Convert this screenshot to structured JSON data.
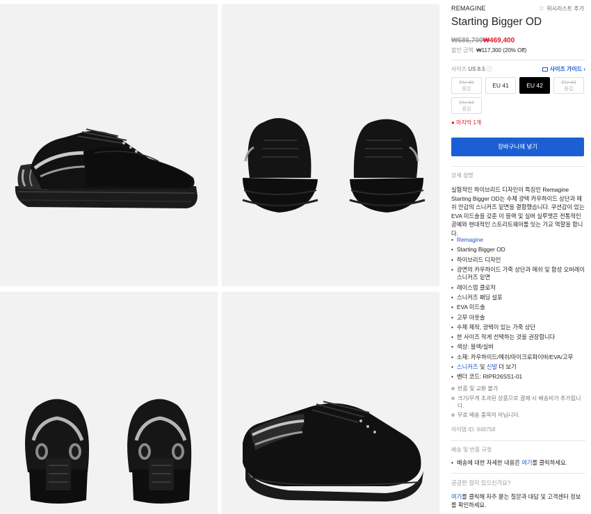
{
  "gallery": {
    "images": [
      {
        "icon": "shoe-side-view-image"
      },
      {
        "icon": "shoe-front-view-image"
      },
      {
        "icon": "shoe-back-view-image"
      },
      {
        "icon": "shoe-angle-view-image"
      }
    ]
  },
  "product": {
    "brand": "REMAGINE",
    "wishlist_label": "위시리스트 추가",
    "title": "Starting Bigger OD",
    "old_price": "₩586,700",
    "new_price": "₩469,400",
    "discount_label": "할인 금액:",
    "discount_value": "₩117,300 (20% Off)"
  },
  "size": {
    "label": "사이즈",
    "selected": "US 8.5",
    "guide_label": "사이즈 가이드",
    "options": [
      {
        "label": "EU 40",
        "sub": "품절",
        "state": "sold"
      },
      {
        "label": "EU 41",
        "sub": "",
        "state": "available"
      },
      {
        "label": "EU 42",
        "sub": "",
        "state": "selected"
      },
      {
        "label": "EU 43",
        "sub": "품절",
        "state": "sold"
      },
      {
        "label": "EU 44",
        "sub": "품절",
        "state": "sold"
      }
    ],
    "stock_note": "마지막 1개"
  },
  "cart": {
    "button_label": "장바구니에 넣기"
  },
  "details": {
    "section_title": "상세 설명",
    "description": "실험적인 하이브리드 디자인이 특징인 Remagine Starting Bigger OD는 수제 광택 카우하이드 상단과 메쉬 안감의 스니커즈 밑면을 결합했습니다. 쿠션감이 있는 EVA 미드솔을 갖춘 이 블랙 및 실버 실루엣은 전통적인 공예와 현대적인 스트리트웨어를 잇는 가교 역할을 합니다.",
    "bullets": [
      {
        "text": "Remagine",
        "link": true
      },
      {
        "text": "Starting Bigger OD",
        "link": false
      },
      {
        "text": "하이브리드 디자인",
        "link": false
      },
      {
        "text": "광면의 카우하이드 가죽 상단과 메쉬 및 합성 오버레이 스니커즈 밑면",
        "link": false
      },
      {
        "text": "레이스업 클로저",
        "link": false
      },
      {
        "text": "스니커즈 패딩 설포",
        "link": false
      },
      {
        "text": "EVA 미드솔",
        "link": false
      },
      {
        "text": "고무 아웃솔",
        "link": false
      },
      {
        "text": "수제 제작, 광택이 있는 가죽 상단",
        "link": false
      },
      {
        "text": "한 사이즈 작게 선택하는 것을 권장합니다",
        "link": false
      },
      {
        "text": "색상: 블랙/실버",
        "link": false
      },
      {
        "text": "소재: 카우하이드/메쉬/마이크로파이버/EVA/고무",
        "link": false
      }
    ],
    "more": {
      "link1": "스니커즈",
      "mid": "및",
      "link2": "신발",
      "tail": "더 보기"
    },
    "vendor_code": "벤더 코드: RIPR26SS1-01",
    "notes": [
      "반품 및 교환 불가",
      "크기/무게 초과된 상품으로 결제 시 배송비가 추가됩니다.",
      "무료 배송 품목이 아닙니다."
    ],
    "item_id": "아이템 ID: 949758"
  },
  "shipping": {
    "section_title": "배송 및 반품 규정",
    "note_prefix": "배송에 대한 자세한 내용은",
    "note_link": "여기",
    "note_suffix": "를 클릭하세요."
  },
  "qa": {
    "title": "궁금한 점이 있으신가요?",
    "link": "여기",
    "body": "를 클릭해 자주 묻는 질문과 대답 및 고객센터 정보를 확인하세요."
  }
}
